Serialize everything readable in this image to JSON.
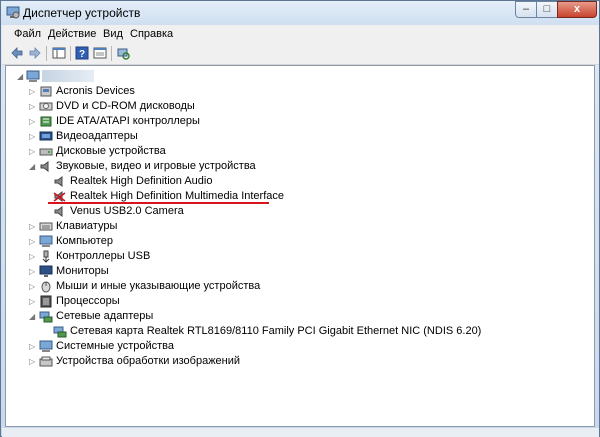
{
  "window": {
    "title": "Диспетчер устройств",
    "close_glyph": "x",
    "min_glyph": "–",
    "max_glyph": "□"
  },
  "menu": [
    "Файл",
    "Действие",
    "Вид",
    "Справка"
  ],
  "tree": {
    "root": {
      "label": "",
      "icon": "computer-icon"
    },
    "items": [
      {
        "label": "Acronis Devices",
        "icon": "device-icon",
        "expanded": false
      },
      {
        "label": "DVD и CD-ROM дисководы",
        "icon": "dvd-drive-icon",
        "expanded": false
      },
      {
        "label": "IDE ATA/ATAPI контроллеры",
        "icon": "ide-controller-icon",
        "expanded": false
      },
      {
        "label": "Видеоадаптеры",
        "icon": "display-adapter-icon",
        "expanded": false
      },
      {
        "label": "Дисковые устройства",
        "icon": "disk-drive-icon",
        "expanded": false
      },
      {
        "label": "Звуковые, видео и игровые устройства",
        "icon": "speaker-icon",
        "expanded": true,
        "children": [
          {
            "label": "Realtek High Definition Audio",
            "icon": "speaker-icon"
          },
          {
            "label": "Realtek High Definition Multimedia Interface",
            "icon": "speaker-disabled-icon",
            "highlighted": true
          },
          {
            "label": "Venus USB2.0 Camera",
            "icon": "speaker-icon"
          }
        ]
      },
      {
        "label": "Клавиатуры",
        "icon": "keyboard-icon",
        "expanded": false
      },
      {
        "label": "Компьютер",
        "icon": "computer-icon",
        "expanded": false
      },
      {
        "label": "Контроллеры USB",
        "icon": "usb-icon",
        "expanded": false
      },
      {
        "label": "Мониторы",
        "icon": "monitor-icon",
        "expanded": false
      },
      {
        "label": "Мыши и иные указывающие устройства",
        "icon": "mouse-icon",
        "expanded": false
      },
      {
        "label": "Процессоры",
        "icon": "processor-icon",
        "expanded": false
      },
      {
        "label": "Сетевые адаптеры",
        "icon": "network-adapter-icon",
        "expanded": true,
        "children": [
          {
            "label": "Сетевая карта Realtek RTL8169/8110 Family PCI Gigabit Ethernet NIC (NDIS 6.20)",
            "icon": "network-adapter-icon"
          }
        ]
      },
      {
        "label": "Системные устройства",
        "icon": "system-device-icon",
        "expanded": false
      },
      {
        "label": "Устройства обработки изображений",
        "icon": "imaging-device-icon",
        "expanded": false
      }
    ]
  },
  "colors": {
    "highlight_underline": "#d9121b",
    "tree_expander": "#777777"
  }
}
